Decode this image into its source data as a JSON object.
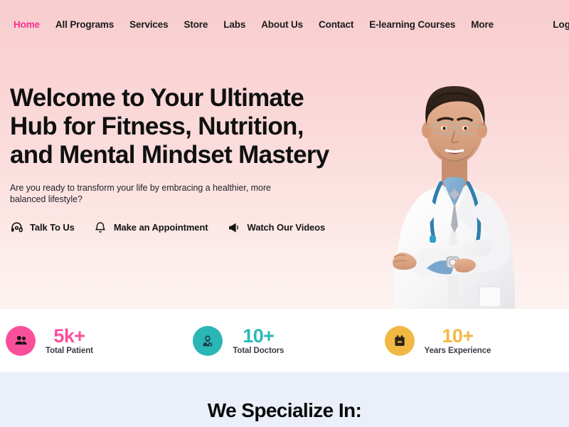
{
  "nav": {
    "links": [
      {
        "label": "Home",
        "active": true
      },
      {
        "label": "All Programs",
        "active": false
      },
      {
        "label": "Services",
        "active": false
      },
      {
        "label": "Store",
        "active": false
      },
      {
        "label": "Labs",
        "active": false
      },
      {
        "label": "About Us",
        "active": false
      },
      {
        "label": "Contact",
        "active": false
      },
      {
        "label": "E-learning Courses",
        "active": false
      },
      {
        "label": "More",
        "active": false
      }
    ],
    "login_label": "Login",
    "active_color": "#fb2f8f",
    "text_color": "#1b1b1b"
  },
  "hero": {
    "title": "Welcome to Your Ultimate Hub for Fitness, Nutrition, and Mental Mindset Mastery",
    "subtitle": "Are you ready to transform your life by embracing a healthier, more balanced lifestyle?",
    "background_top_color": "#f8cdd0",
    "background_bottom_color": "#fdf3f1",
    "ctas": [
      {
        "label": "Talk To Us",
        "icon": "headset-icon"
      },
      {
        "label": "Make an Appointment",
        "icon": "bell-icon"
      },
      {
        "label": "Watch Our Videos",
        "icon": "megaphone-icon"
      }
    ],
    "image_alt": "Smiling male doctor in white coat with stethoscope and glasses, arms crossed"
  },
  "stats": [
    {
      "value": "5k+",
      "label": "Total Patient",
      "icon": "people-icon",
      "badge_color": "#f94f9a",
      "value_color": "#f94f9a"
    },
    {
      "value": "10+",
      "label": "Total Doctors",
      "icon": "doctor-icon",
      "badge_color": "#2bb6b6",
      "value_color": "#2bb6b6"
    },
    {
      "value": "10+",
      "label": "Years Experience",
      "icon": "calendar-icon",
      "badge_color": "#f1b943",
      "value_color": "#f1b943"
    }
  ],
  "specialize": {
    "title": "We Specialize In:",
    "background_color": "#eaeffa"
  }
}
